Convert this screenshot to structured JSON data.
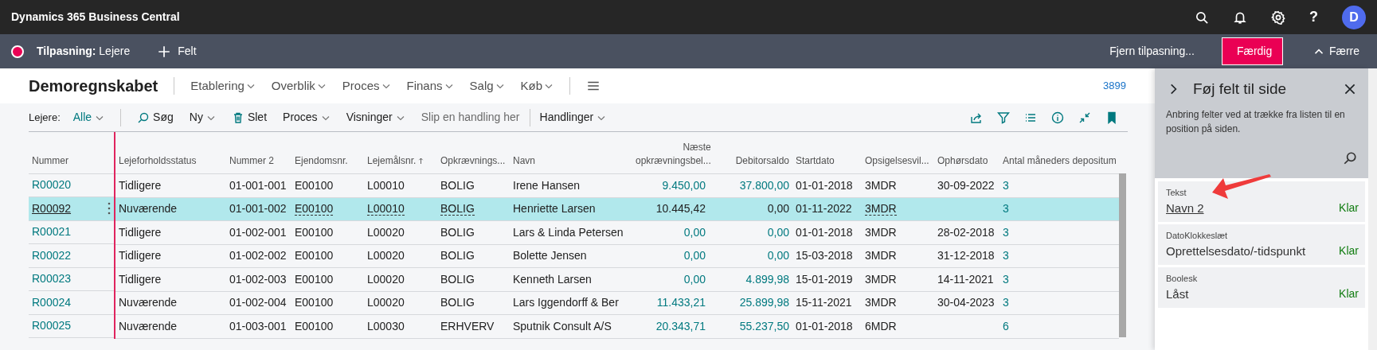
{
  "app_bar": {
    "title": "Dynamics 365 Business Central",
    "help_label": "?",
    "avatar_initial": "D"
  },
  "customize_bar": {
    "label": "**Tilpasning:** Lejere",
    "add_field": "Felt",
    "reset": "Fjern tilpasning...",
    "done": "Færdig",
    "collapse": "Færre"
  },
  "nav": {
    "company": "Demoregnskabet",
    "menus": [
      "Etablering",
      "Overblik",
      "Proces",
      "Finans",
      "Salg",
      "Køb"
    ],
    "count": "3899"
  },
  "action_bar": {
    "filter_label": "Lejere:",
    "filter_value": "Alle",
    "actions": [
      {
        "kind": "search",
        "label": "Søg"
      },
      {
        "kind": "menu",
        "label": "Ny"
      },
      {
        "kind": "delete",
        "label": "Slet"
      },
      {
        "kind": "menu",
        "label": "Proces"
      },
      {
        "kind": "menu",
        "label": "Visninger"
      },
      {
        "kind": "drop-zone",
        "label": "Slip en handling her"
      },
      {
        "kind": "divider"
      },
      {
        "kind": "menu",
        "label": "Handlinger"
      }
    ]
  },
  "table": {
    "columns": [
      {
        "label": "Nummer",
        "kind": "link",
        "sorted": false
      },
      {
        "label": "Lejeforholdsstatus",
        "kind": "text",
        "sorted": false
      },
      {
        "label": "Nummer 2",
        "kind": "text",
        "sorted": false
      },
      {
        "label": "Ejendomsnr.",
        "kind": "editable",
        "sorted": false
      },
      {
        "label": "Lejemålsnr.",
        "kind": "editable",
        "sorted": true
      },
      {
        "label": "Opkrævnings...",
        "kind": "editable",
        "sorted": false
      },
      {
        "label": "Navn",
        "kind": "text",
        "sorted": false
      },
      {
        "label": "Næste opkrævningsbel...",
        "kind": "amount",
        "sorted": false
      },
      {
        "label": "Debitorsaldo",
        "kind": "amount",
        "sorted": false
      },
      {
        "label": "Startdato",
        "kind": "text",
        "sorted": false
      },
      {
        "label": "Opsigelsesvil...",
        "kind": "editable",
        "sorted": false
      },
      {
        "label": "Ophørsdato",
        "kind": "text",
        "sorted": false
      },
      {
        "label": "Antal måneders depositum",
        "kind": "count",
        "sorted": false
      }
    ],
    "rows": [
      {
        "selected": false,
        "cells": [
          "R00020",
          "Tidligere",
          "01-001-001",
          "E00100",
          "L00010",
          "BOLIG",
          "Irene Hansen",
          "9.450,00",
          "37.800,00",
          "01-01-2018",
          "3MDR",
          "30-09-2022",
          "3"
        ]
      },
      {
        "selected": true,
        "cells": [
          "R00092",
          "Nuværende",
          "01-001-002",
          "E00100",
          "L00010",
          "BOLIG",
          "Henriette Larsen",
          "10.445,42",
          "0,00",
          "01-11-2022",
          "3MDR",
          "",
          "3"
        ]
      },
      {
        "selected": false,
        "cells": [
          "R00021",
          "Tidligere",
          "01-002-001",
          "E00100",
          "L00020",
          "BOLIG",
          "Lars & Linda Petersen",
          "0,00",
          "0,00",
          "01-01-2018",
          "3MDR",
          "28-02-2018",
          "3"
        ]
      },
      {
        "selected": false,
        "cells": [
          "R00022",
          "Tidligere",
          "01-002-002",
          "E00100",
          "L00020",
          "BOLIG",
          "Bolette Jensen",
          "0,00",
          "0,00",
          "15-03-2018",
          "3MDR",
          "31-12-2018",
          "3"
        ]
      },
      {
        "selected": false,
        "cells": [
          "R00023",
          "Tidligere",
          "01-002-003",
          "E00100",
          "L00020",
          "BOLIG",
          "Kenneth Larsen",
          "0,00",
          "4.899,98",
          "15-01-2019",
          "3MDR",
          "14-11-2021",
          "3"
        ]
      },
      {
        "selected": false,
        "cells": [
          "R00024",
          "Nuværende",
          "01-002-004",
          "E00100",
          "L00020",
          "BOLIG",
          "Lars Iggendorff & Ber",
          "11.433,21",
          "25.899,98",
          "15-11-2021",
          "3MDR",
          "30-04-2023",
          "3"
        ]
      },
      {
        "selected": false,
        "cells": [
          "R00025",
          "Nuværende",
          "01-003-001",
          "E00100",
          "L00030",
          "ERHVERV",
          "Sputnik Consult A/S",
          "20.343,71",
          "55.237,50",
          "01-01-2018",
          "6MDR",
          "",
          "6"
        ]
      }
    ]
  },
  "panel": {
    "title": "Føj felt til side",
    "description": "Anbring felter ved at trække fra listen til en position på siden.",
    "fields": [
      {
        "type": "Tekst",
        "name": "Navn 2",
        "status": "Klar",
        "selected": true
      },
      {
        "type": "DatoKlokkeslæt",
        "name": "Oprettelsesdato/-tidspunkt",
        "status": "Klar",
        "selected": false
      },
      {
        "type": "Boolesk",
        "name": "Låst",
        "status": "Klar",
        "selected": false
      }
    ]
  }
}
